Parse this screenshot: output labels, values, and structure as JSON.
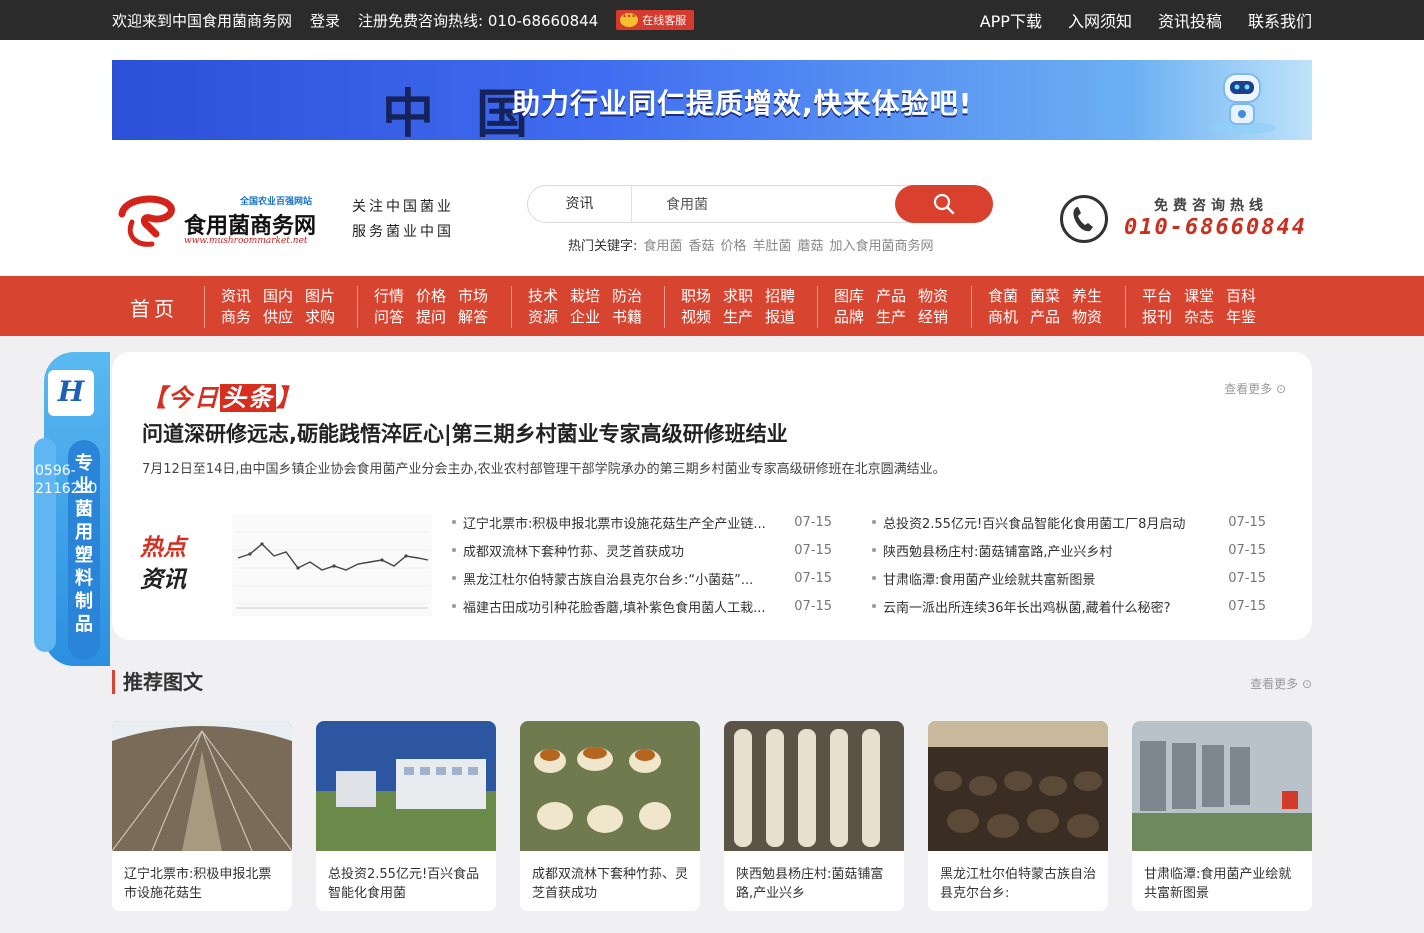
{
  "topbar": {
    "welcome": "欢迎来到中国食用菌商务网",
    "login": "登录",
    "register": "注册免费咨询热线: 010-68660844",
    "online_service": "在线客服",
    "links": [
      "APP下载",
      "入网须知",
      "资讯投稿",
      "联系我们"
    ]
  },
  "banner": {
    "big_text": "中 国",
    "slogan": "助力行业同仁提质增效,快来体验吧!"
  },
  "logo": {
    "tag": "全国农业百强网站",
    "name": "食用菌商务网",
    "url": "www.mushroommarket.net"
  },
  "motto": [
    "关注中国菌业",
    "服务菌业中国"
  ],
  "search": {
    "category": "资讯",
    "value": "食用菌",
    "hot_label": "热门关键字:",
    "hot_words": [
      "食用菌",
      "香菇",
      "价格",
      "羊肚菌",
      "蘑菇",
      "加入食用菌商务网"
    ]
  },
  "hotline": {
    "label": "免费咨询热线",
    "number": "010-68660844"
  },
  "nav": {
    "home": "首页",
    "groups": [
      [
        "资讯",
        "国内",
        "图片",
        "商务",
        "供应",
        "求购"
      ],
      [
        "行情",
        "价格",
        "市场",
        "问答",
        "提问",
        "解答"
      ],
      [
        "技术",
        "栽培",
        "防治",
        "资源",
        "企业",
        "书籍"
      ],
      [
        "职场",
        "求职",
        "招聘",
        "视频",
        "生产",
        "报道"
      ],
      [
        "图库",
        "产品",
        "物资",
        "品牌",
        "生产",
        "经销"
      ],
      [
        "食菌",
        "菌菜",
        "养生",
        "商机",
        "产品",
        "物资"
      ],
      [
        "平台",
        "课堂",
        "百科",
        "报刊",
        "杂志",
        "年鉴"
      ]
    ]
  },
  "headlines": {
    "today_prefix": "【今日",
    "today_highlight": "头条",
    "today_suffix": "】",
    "more": "查看更多",
    "title": "问道深研修远志,砺能践悟淬匠心|第三期乡村菌业专家高级研修班结业",
    "summary": "7月12日至14日,由中国乡镇企业协会食用菌产业分会主办,农业农村部管理干部学院承办的第三期乡村菌业专家高级研修班在北京圆满结业。",
    "hot_label_red": "热点",
    "hot_label_black": "资讯",
    "left_news": [
      {
        "title": "辽宁北票市:积极申报北票市设施花菇生产全产业链...",
        "date": "07-15"
      },
      {
        "title": "成都双流林下套种竹荪、灵芝首获成功",
        "date": "07-15"
      },
      {
        "title": "黑龙江杜尔伯特蒙古族自治县克尔台乡:“小菌菇”...",
        "date": "07-15"
      },
      {
        "title": "福建古田成功引种花脸香蘑,填补紫色食用菌人工栽...",
        "date": "07-15"
      }
    ],
    "right_news": [
      {
        "title": "总投资2.55亿元!百兴食品智能化食用菌工厂8月启动",
        "date": "07-15"
      },
      {
        "title": "陕西勉县杨庄村:菌菇铺富路,产业兴乡村",
        "date": "07-15"
      },
      {
        "title": "甘肃临潭:食用菌产业绘就共富新图景",
        "date": "07-15"
      },
      {
        "title": "云南一派出所连续36年长出鸡枞菌,藏着什么秘密?",
        "date": "07-15"
      }
    ]
  },
  "side_ad": {
    "logo_letter": "H",
    "vertical_text": "专业菌用塑料制品",
    "phone": "0596-2116290"
  },
  "recommended": {
    "title": "推荐图文",
    "more": "查看更多",
    "items": [
      {
        "caption": "辽宁北票市:积极申报北票市设施花菇生",
        "tone": "#6b5a4a"
      },
      {
        "caption": "总投资2.55亿元!百兴食品智能化食用菌",
        "tone": "#3d6aa8"
      },
      {
        "caption": "成都双流林下套种竹荪、灵芝首获成功",
        "tone": "#b7884a"
      },
      {
        "caption": "陕西勉县杨庄村:菌菇铺富路,产业兴乡",
        "tone": "#cfc4a8"
      },
      {
        "caption": "黑龙江杜尔伯特蒙古族自治县克尔台乡:",
        "tone": "#4a3a2c"
      },
      {
        "caption": "甘肃临潭:食用菌产业绘就共富新图景",
        "tone": "#8f9aa3"
      }
    ]
  }
}
